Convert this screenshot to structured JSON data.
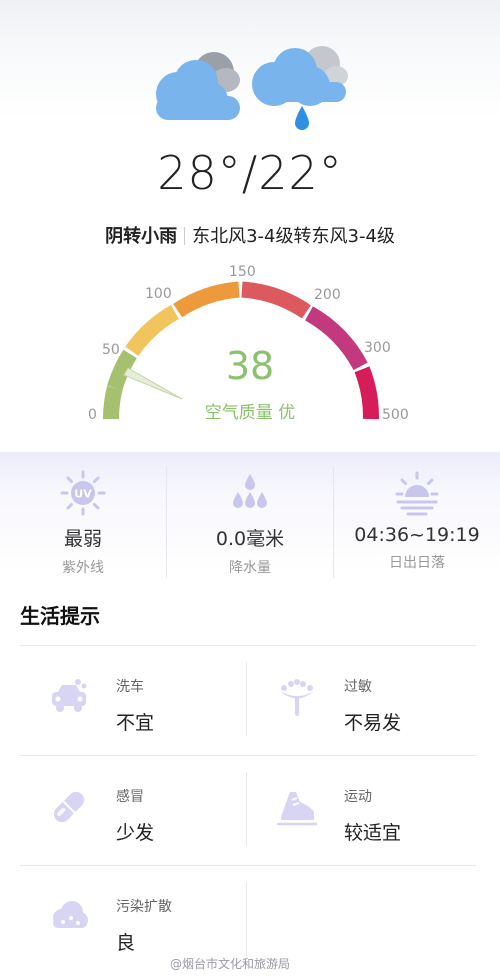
{
  "weather": {
    "temperature": "28°/22°",
    "condition": "阴转小雨",
    "wind": "东北风3-4级转东风3-4级"
  },
  "aqi": {
    "value": "38",
    "label": "空气质量 优",
    "level": 38,
    "scale_labels": [
      "0",
      "50",
      "100",
      "150",
      "200",
      "300",
      "500"
    ],
    "colors": {
      "good": "#a5c06e",
      "moderate": "#f2c45c",
      "sensitive": "#ec9a3c",
      "unhealthy": "#dc5a5e",
      "very_unhealthy": "#c2397e",
      "hazardous": "#d61c59",
      "value_text": "#8cc16e"
    }
  },
  "stats": [
    {
      "icon": "uv-icon",
      "value": "最弱",
      "label": "紫外线"
    },
    {
      "icon": "rain-drops-icon",
      "value": "0.0毫米",
      "label": "降水量"
    },
    {
      "icon": "sunrise-icon",
      "value": "04:36~19:19",
      "label": "日出日落"
    }
  ],
  "life": {
    "title": "生活提示",
    "tips": [
      {
        "icon": "car-wash-icon",
        "label": "洗车",
        "value": "不宜"
      },
      {
        "icon": "allergy-icon",
        "label": "过敏",
        "value": "不易发"
      },
      {
        "icon": "pill-icon",
        "label": "感冒",
        "value": "少发"
      },
      {
        "icon": "sneaker-icon",
        "label": "运动",
        "value": "较适宜"
      },
      {
        "icon": "pollution-cloud-icon",
        "label": "污染扩散",
        "value": "良"
      }
    ]
  },
  "watermark": "@烟台市文化和旅游局",
  "icon_color": "#d8d4f4"
}
